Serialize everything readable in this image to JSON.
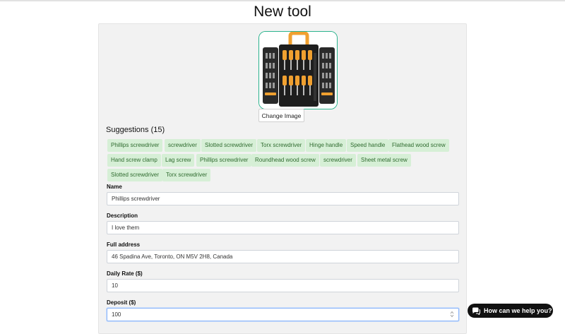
{
  "page": {
    "title": "New tool"
  },
  "image": {
    "change_label": "Change Image"
  },
  "suggestions": {
    "title": "Suggestions (15)",
    "chips": [
      "Phillips screwdriver",
      "screwdriver",
      "Slotted screwdriver",
      "Torx screwdriver",
      "Hinge handle",
      "Speed handle",
      "Flathead wood screw",
      "Hand screw clamp",
      "Lag screw",
      "Phillips screwdriver",
      "Roundhead wood screw",
      "screwdriver",
      "Sheet metal screw",
      "Slotted screwdriver",
      "Torx screwdriver"
    ]
  },
  "form": {
    "name": {
      "label": "Name",
      "value": "Phillips screwdriver"
    },
    "description": {
      "label": "Description",
      "value": "I love them"
    },
    "address": {
      "label": "Full address",
      "value": "46 Spadina Ave, Toronto, ON M5V 2H8, Canada"
    },
    "daily_rate": {
      "label": "Daily Rate ($)",
      "value": "10"
    },
    "deposit": {
      "label": "Deposit ($)",
      "value": "100"
    }
  },
  "help": {
    "label": "How can we help you?"
  },
  "colors": {
    "chip_bg": "#d6efd6",
    "chip_text": "#2f6b2f",
    "image_border": "#2bb38d",
    "focus_border": "#8ab4f8"
  }
}
